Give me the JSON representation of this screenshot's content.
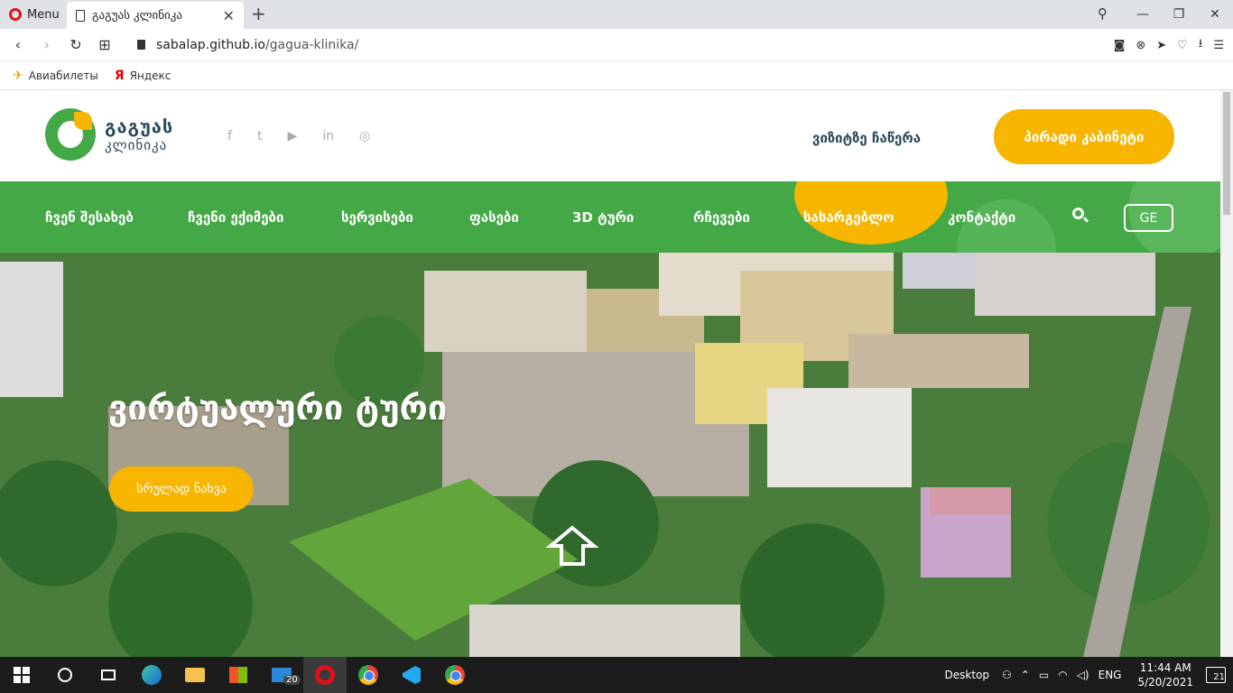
{
  "browser": {
    "menu_label": "Menu",
    "tab_title": "გაგუას კლინიკა",
    "tab_close": "✕",
    "new_tab": "+",
    "url_domain": "sabalap.github.io",
    "url_path": "/gagua-klinika/",
    "window_min": "—",
    "window_max": "❐",
    "window_close": "✕",
    "bookmarks": [
      {
        "label": "Авиабилеты",
        "icon": "plane-icon"
      },
      {
        "label": "Яндекс",
        "icon": "yandex-icon"
      }
    ]
  },
  "site": {
    "logo_title": "გაგუას",
    "logo_sub": "კლინიკა",
    "socials": [
      "f",
      "t",
      "▶",
      "in",
      "◎"
    ],
    "visit_link": "ვიზიტზე ჩაწერა",
    "cabinet_button": "პირადი კაბინეტი",
    "nav": [
      "ჩვენ შესახებ",
      "ჩვენი ექიმები",
      "სერვისები",
      "ფასები",
      "3D ტური",
      "რჩევები",
      "სასარგებლო",
      "კონტაქტი"
    ],
    "lang": "GE",
    "hero_title": "ვირტუალური ტური",
    "hero_button": "სრულად ნახვა",
    "colors": {
      "green": "#43a845",
      "yellow": "#f7b500",
      "dark_text": "#2b4a5a"
    }
  },
  "taskbar": {
    "mail_badge": "20",
    "desktop_label": "Desktop",
    "lang": "ENG",
    "time": "11:44 AM",
    "date": "5/20/2021",
    "notifications": "21"
  }
}
